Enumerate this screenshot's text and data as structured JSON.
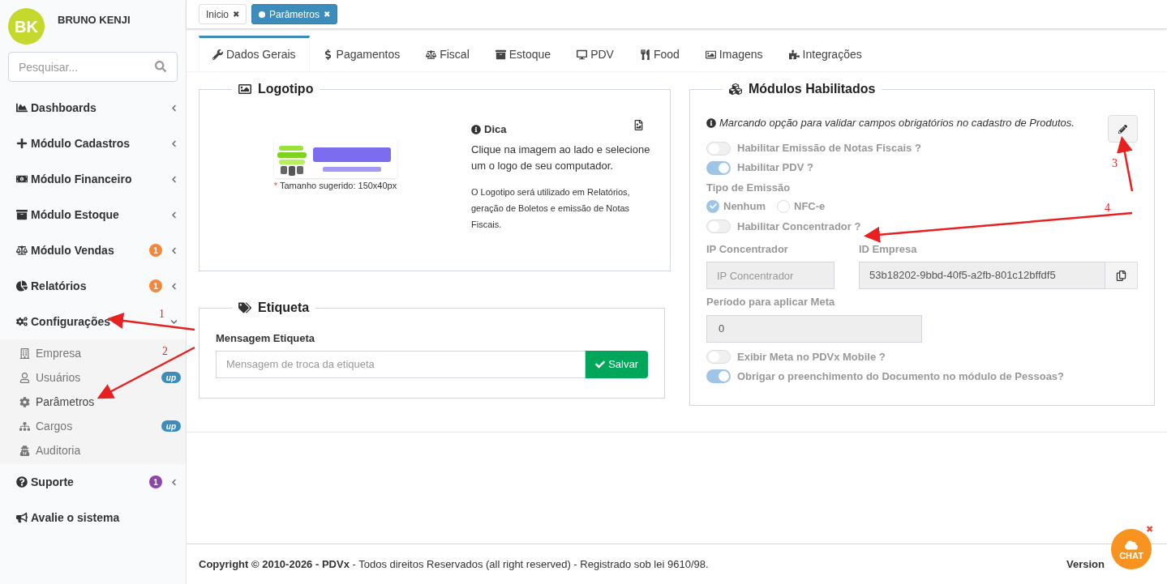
{
  "user": {
    "initials": "BK",
    "name": "BRUNO KENJI"
  },
  "search": {
    "placeholder": "Pesquisar..."
  },
  "sidebar": {
    "items": [
      {
        "label": "Dashboards",
        "expanded": false
      },
      {
        "label": "Módulo Cadastros",
        "expanded": false
      },
      {
        "label": "Módulo Financeiro",
        "expanded": false
      },
      {
        "label": "Módulo Estoque",
        "expanded": false
      },
      {
        "label": "Módulo Vendas",
        "expanded": false,
        "badge": "1",
        "color": "#f5873a"
      },
      {
        "label": "Relatórios",
        "expanded": false,
        "badge": "1",
        "color": "#f5873a"
      },
      {
        "label": "Configurações",
        "expanded": true,
        "children": [
          {
            "label": "Empresa",
            "selected": false
          },
          {
            "label": "Usuários",
            "selected": false,
            "badge": "up",
            "color": "#3c8dbc"
          },
          {
            "label": "Parâmetros",
            "selected": true
          },
          {
            "label": "Cargos",
            "selected": false,
            "badge": "up",
            "color": "#3c8dbc"
          },
          {
            "label": "Auditoria",
            "selected": false
          }
        ]
      },
      {
        "label": "Suporte",
        "expanded": false,
        "badge": "1",
        "color": "#8e44ad"
      },
      {
        "label": "Avalie o sistema"
      }
    ]
  },
  "open_tabs": [
    {
      "label": "Inicio",
      "selected": false,
      "close": "✖"
    },
    {
      "label": "Parâmetros",
      "selected": true,
      "close": "✖"
    }
  ],
  "tabs": [
    {
      "label": "Dados Gerais",
      "selected": true
    },
    {
      "label": "Pagamentos",
      "selected": false
    },
    {
      "label": "Fiscal",
      "selected": false
    },
    {
      "label": "Estoque",
      "selected": false
    },
    {
      "label": "PDV",
      "selected": false
    },
    {
      "label": "Food",
      "selected": false
    },
    {
      "label": "Imagens",
      "selected": false
    },
    {
      "label": "Integrações",
      "selected": false
    }
  ],
  "logo_panel": {
    "title": "Logotipo",
    "size_mark": "*",
    "size_hint": "Tamanho sugerido: 150x40px",
    "tip_title": "Dica",
    "tip_text": "Clique na imagem ao lado e selecione um o logo de seu computador.",
    "note": "O Logotipo será utilizado em Relatórios, geração de Boletos e emissão de Notas Fiscais."
  },
  "label_panel": {
    "title": "Etiqueta",
    "field_label": "Mensagem Etiqueta",
    "placeholder": "Mensagem de troca da etiqueta",
    "button": "Salvar"
  },
  "modules_panel": {
    "title": "Módulos Habilitados",
    "info": "Marcando opção para validar campos obrigatórios no cadastro de Produtos.",
    "toggles_top": [
      {
        "label": "Habilitar Emissão de Notas Fiscais ?",
        "on": false
      },
      {
        "label": "Habilitar PDV ?",
        "on": true
      }
    ],
    "emission": {
      "label": "Tipo de Emissão",
      "options": [
        {
          "label": "Nenhum",
          "selected": true
        },
        {
          "label": "NFC-e",
          "selected": false
        }
      ]
    },
    "toggle_concentrator": {
      "label": "Habilitar Concentrador ?",
      "on": false
    },
    "ip": {
      "label": "IP Concentrador",
      "placeholder": "IP Concentrador"
    },
    "company_id": {
      "label": "ID Empresa",
      "value": "53b18202-9bbd-40f5-a2fb-801c12bffdf5"
    },
    "period": {
      "label": "Período para aplicar Meta",
      "value": "0"
    },
    "toggles_bottom": [
      {
        "label": "Exibir Meta no PDVx Mobile ?",
        "on": false
      },
      {
        "label": "Obrigar o preenchimento do Documento no módulo de Pessoas?",
        "on": true
      }
    ]
  },
  "annotations": [
    {
      "label": "1"
    },
    {
      "label": "2"
    },
    {
      "label": "3"
    },
    {
      "label": "4"
    }
  ],
  "footer": {
    "copyright": "**Copyright © 2010-2026 - PDVx** - Todos direitos Reservados (all right reserved) - Registrado sob lei 9610/98.",
    "version": "Version"
  },
  "chat": {
    "label": "CHAT",
    "close": "✖"
  }
}
